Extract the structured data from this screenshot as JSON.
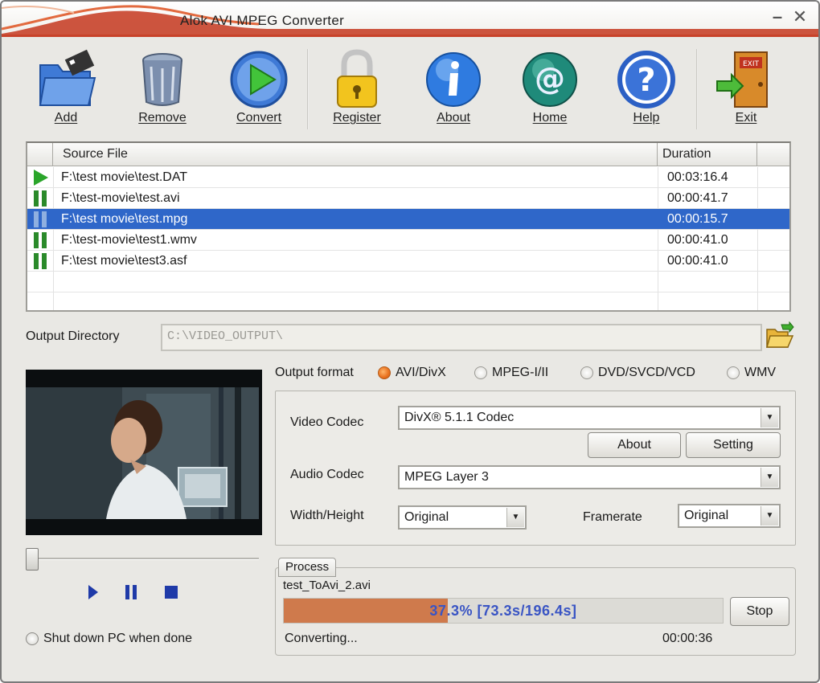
{
  "app": {
    "title": "Alok AVI MPEG Converter"
  },
  "toolbar": {
    "add": "Add",
    "remove": "Remove",
    "convert": "Convert",
    "register": "Register",
    "about": "About",
    "home": "Home",
    "help": "Help",
    "exit": "Exit"
  },
  "file_list": {
    "col_source": "Source File",
    "col_duration": "Duration",
    "rows": [
      {
        "state": "playing",
        "file": "F:\\test movie\\test.DAT",
        "duration": "00:03:16.4"
      },
      {
        "state": "paused",
        "file": "F:\\test-movie\\test.avi",
        "duration": "00:00:41.7"
      },
      {
        "state": "paused",
        "file": "F:\\test movie\\test.mpg",
        "duration": "00:00:15.7",
        "selected": true
      },
      {
        "state": "paused",
        "file": "F:\\test-movie\\test1.wmv",
        "duration": "00:00:41.0"
      },
      {
        "state": "paused",
        "file": "F:\\test movie\\test3.asf",
        "duration": "00:00:41.0"
      }
    ]
  },
  "output_dir": {
    "label": "Output Directory",
    "value": "C:\\VIDEO_OUTPUT\\"
  },
  "output_format": {
    "label": "Output format",
    "options": [
      "AVI/DivX",
      "MPEG-I/II",
      "DVD/SVCD/VCD",
      "WMV"
    ],
    "selected": "AVI/DivX"
  },
  "codec": {
    "video_label": "Video Codec",
    "video_value": "DivX® 5.1.1 Codec",
    "about_button": "About",
    "setting_button": "Setting",
    "audio_label": "Audio Codec",
    "audio_value": "MPEG Layer 3",
    "size_label": "Width/Height",
    "size_value": "Original",
    "framerate_label": "Framerate",
    "framerate_value": "Original"
  },
  "process": {
    "tab_label": "Process",
    "file": "test_ToAvi_2.avi",
    "progress_text": "37.3%  [73.3s/196.4s]",
    "progress_fraction": 0.373,
    "stop_button": "Stop",
    "status": "Converting...",
    "elapsed": "00:00:36"
  },
  "player": {
    "seek_fraction": 0.0
  },
  "shutdown": {
    "label": "Shut down PC when done",
    "checked": false
  },
  "colors": {
    "selection": "#2f67c9",
    "progress_fill": "#cf7a4c",
    "progress_text": "#3a55c4",
    "title_accent": "#c8422a",
    "format_radio": "#e8701d"
  }
}
